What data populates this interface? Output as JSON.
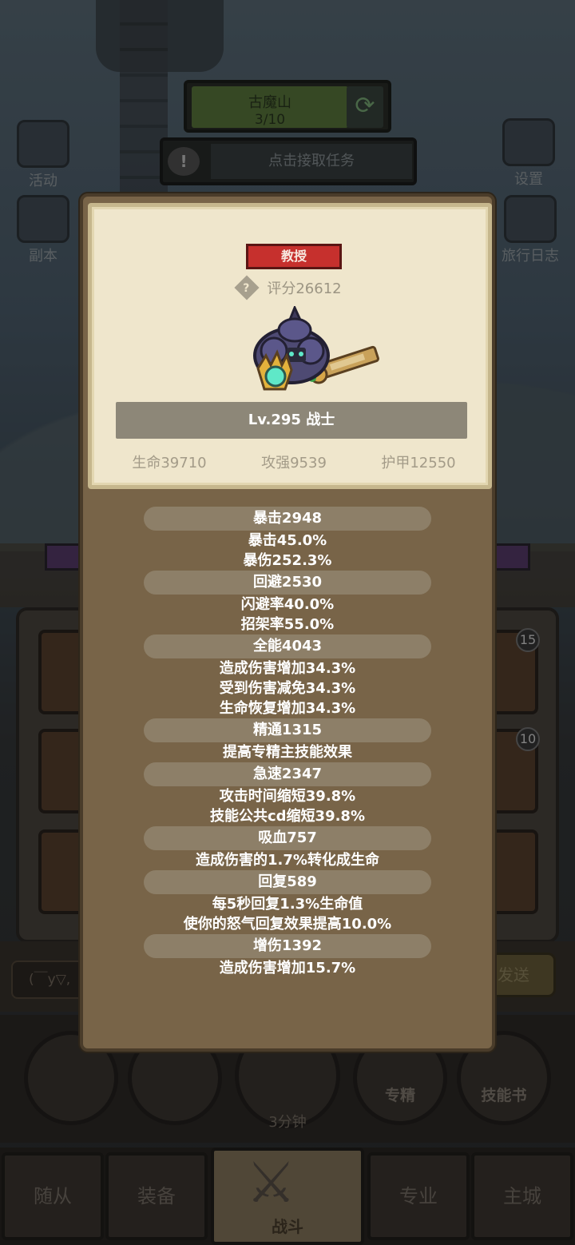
{
  "hud": {
    "map_name": "古魔山",
    "map_progress": "3/10",
    "quest_text": "点击接取任务",
    "left_buttons": [
      "活动",
      "副本"
    ],
    "right_buttons": [
      "设置",
      "旅行日志"
    ]
  },
  "background_slots": {
    "badge_1": "15",
    "badge_2": "10"
  },
  "chat": {
    "input_text": "(￣y▽,",
    "send_label": "发送"
  },
  "skills": {
    "timer": "3分钟",
    "spec_label": "专精",
    "book_label": "技能书"
  },
  "nav": {
    "tabs": [
      "随从",
      "装备",
      "战斗",
      "专业",
      "主城"
    ],
    "active": "战斗"
  },
  "hero_card": {
    "rank": "教授",
    "score": "评分26612",
    "level_class": "Lv.295 战士",
    "hp": "生命39710",
    "attack": "攻强9539",
    "armor": "护甲12550"
  },
  "stats": {
    "crit": {
      "header": "暴击2948",
      "lines": [
        "暴击45.0%",
        "暴伤252.3%"
      ]
    },
    "dodge": {
      "header": "回避2530",
      "lines": [
        "闪避率40.0%",
        "招架率55.0%"
      ]
    },
    "versatility": {
      "header": "全能4043",
      "lines": [
        "造成伤害增加34.3%",
        "受到伤害减免34.3%",
        "生命恢复增加34.3%"
      ]
    },
    "mastery": {
      "header": "精通1315",
      "lines": [
        "提高专精主技能效果"
      ]
    },
    "haste": {
      "header": "急速2347",
      "lines": [
        "攻击时间缩短39.8%",
        "技能公共cd缩短39.8%"
      ]
    },
    "lifesteal": {
      "header": "吸血757",
      "lines": [
        "造成伤害的1.7%转化成生命"
      ]
    },
    "regen": {
      "header": "回复589",
      "lines": [
        "每5秒回复1.3%生命值",
        "使你的怒气回复效果提高10.0%"
      ]
    },
    "dmg_bonus": {
      "header": "增伤1392",
      "lines": [
        "造成伤害增加15.7%"
      ]
    }
  },
  "colors": {
    "rank_badge": "#c6302d",
    "panel": "#786448",
    "card": "#efe6cc"
  }
}
